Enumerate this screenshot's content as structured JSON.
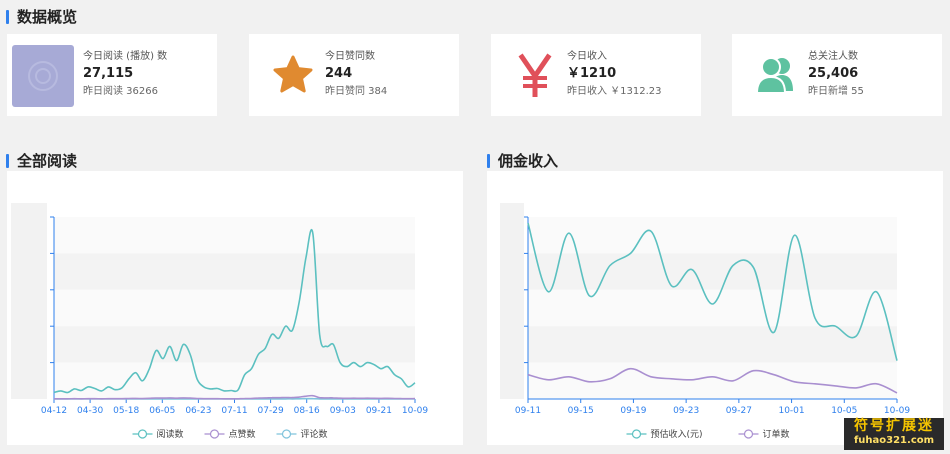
{
  "overview": {
    "title": "数据概览",
    "cards": [
      {
        "label": "今日阅读 (播放) 数",
        "value": "27,115",
        "sub": "昨日阅读 36266",
        "icon": "reading-thumbnail-icon"
      },
      {
        "label": "今日赞同数",
        "value": "244",
        "sub": "昨日赞同 384",
        "icon": "star-icon"
      },
      {
        "label": "今日收入",
        "value": "￥1210",
        "sub": "昨日收入 ￥1312.23",
        "icon": "yen-icon"
      },
      {
        "label": "总关注人数",
        "value": "25,406",
        "sub": "昨日新增 55",
        "icon": "users-icon"
      }
    ]
  },
  "colors": {
    "accent": "#2f80ed",
    "teal": "#5bc0c0",
    "purple": "#a98fd0",
    "star": "#e08a30",
    "yen": "#e0505a",
    "users": "#5ec2a0"
  },
  "reading_panel": {
    "title": "全部阅读"
  },
  "income_panel": {
    "title": "佣金收入"
  },
  "watermark": {
    "line1": "符号扩展迷",
    "line2": "fuhao321.com"
  },
  "chart_data": [
    {
      "type": "line",
      "title": "",
      "categories": [
        "04-12",
        "04-30",
        "05-18",
        "06-05",
        "06-23",
        "07-11",
        "07-29",
        "08-16",
        "09-03",
        "09-21",
        "10-09"
      ],
      "ylim": [
        0,
        45000
      ],
      "legend": [
        "阅读数",
        "点赞数",
        "评论数"
      ],
      "series": [
        {
          "name": "阅读数",
          "values": [
            1600,
            2000,
            1600,
            2500,
            2100,
            3000,
            2600,
            2000,
            3000,
            2300,
            2800,
            5000,
            6500,
            4500,
            7500,
            12000,
            10000,
            13000,
            9500,
            13500,
            11000,
            5000,
            3000,
            2500,
            2600,
            2000,
            2100,
            2200,
            6000,
            7500,
            11000,
            12500,
            16000,
            15000,
            18000,
            17000,
            24000,
            35000,
            41000,
            16000,
            13000,
            13500,
            9000,
            8000,
            9000,
            8000,
            9000,
            8500,
            7500,
            8000,
            6000,
            5000,
            3000,
            4000
          ]
        },
        {
          "name": "点赞数",
          "values": [
            50,
            60,
            50,
            70,
            60,
            80,
            70,
            60,
            80,
            70,
            80,
            120,
            150,
            110,
            170,
            250,
            220,
            270,
            210,
            280,
            230,
            120,
            80,
            70,
            70,
            60,
            60,
            60,
            130,
            160,
            230,
            260,
            330,
            310,
            370,
            350,
            480,
            700,
            820,
            330,
            270,
            280,
            190,
            170,
            190,
            170,
            190,
            180,
            160,
            170,
            130,
            110,
            70,
            90
          ]
        },
        {
          "name": "评论数",
          "values": [
            5,
            6,
            5,
            7,
            6,
            8,
            7,
            6,
            8,
            7,
            8,
            12,
            15,
            11,
            17,
            25,
            22,
            27,
            21,
            28,
            23,
            12,
            8,
            7,
            7,
            6,
            6,
            6,
            13,
            16,
            23,
            26,
            33,
            31,
            37,
            35,
            48,
            70,
            82,
            33,
            27,
            28,
            19,
            17,
            19,
            17,
            19,
            18,
            16,
            17,
            13,
            11,
            7,
            9
          ]
        }
      ]
    },
    {
      "type": "line",
      "title": "",
      "categories": [
        "09-11",
        "09-15",
        "09-19",
        "09-23",
        "09-27",
        "10-01",
        "10-05",
        "10-09"
      ],
      "ylim": [
        0,
        900
      ],
      "legend": [
        "预估收入(元)",
        "订单数"
      ],
      "series": [
        {
          "name": "预估收入(元)",
          "values": [
            870,
            530,
            820,
            510,
            660,
            720,
            830,
            560,
            640,
            470,
            660,
            650,
            330,
            810,
            400,
            360,
            310,
            530,
            190
          ]
        },
        {
          "name": "订单数",
          "values": [
            120,
            95,
            110,
            85,
            100,
            150,
            110,
            100,
            95,
            110,
            90,
            140,
            120,
            85,
            75,
            65,
            55,
            75,
            30
          ]
        }
      ]
    }
  ]
}
